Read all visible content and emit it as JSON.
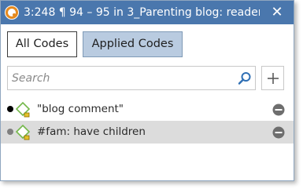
{
  "window": {
    "title": "3:248 ¶ 94 – 95 in 3_Parenting blog: reader...",
    "close_glyph": "✕",
    "accent_color": "#4a77ad"
  },
  "tabs": [
    {
      "label": "All Codes",
      "active": false
    },
    {
      "label": "Applied Codes",
      "active": true
    }
  ],
  "search": {
    "placeholder": "Search",
    "value": "",
    "icon": "search-icon"
  },
  "add_button": {
    "icon": "plus-icon"
  },
  "codes": [
    {
      "label": "\"blog comment\"",
      "bullet_color": "#000000",
      "selected": false,
      "remove_icon": "minus-circle-icon"
    },
    {
      "label": "#fam: have children",
      "bullet_color": "#7f7f7f",
      "selected": true,
      "remove_icon": "minus-circle-icon"
    }
  ]
}
